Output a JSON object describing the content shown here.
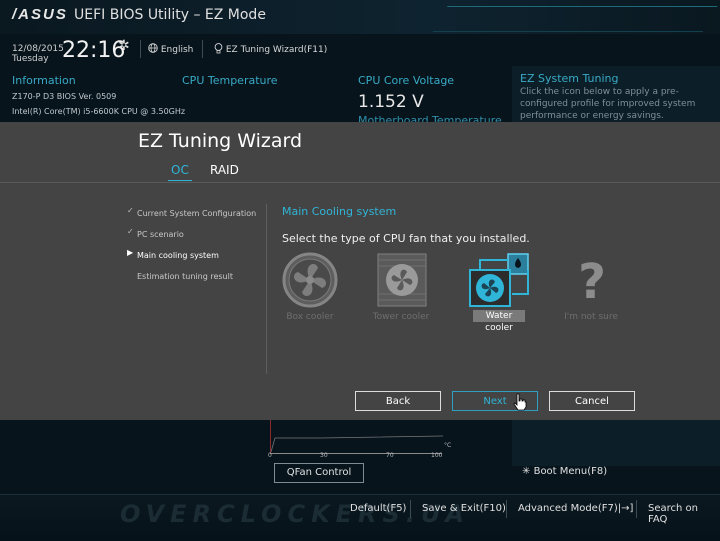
{
  "header": {
    "logo": "/ASUS",
    "title": "UEFI BIOS Utility – EZ Mode"
  },
  "topbar": {
    "date": "12/08/2015",
    "day": "Tuesday",
    "time": "22:16",
    "language": "English",
    "wizard": "EZ Tuning Wizard(F11)"
  },
  "info": {
    "heading": "Information",
    "board": "Z170-P D3    BIOS Ver. 0509",
    "cpu": "Intel(R) Core(TM) i5-6600K CPU @ 3.50GHz"
  },
  "cpu_temp": {
    "heading": "CPU Temperature"
  },
  "cpu_voltage": {
    "heading": "CPU Core Voltage",
    "value": "1.152 V",
    "sub_heading": "Motherboard Temperature"
  },
  "ez_system_tuning": {
    "heading": "EZ System Tuning",
    "description": "Click the icon below to apply a pre-configured profile for improved system performance or energy savings."
  },
  "fan_chart": {
    "ticks": [
      "0",
      "30",
      "70",
      "100"
    ],
    "unit": "°C"
  },
  "qfan_button": "QFan Control",
  "boot_menu": "Boot Menu(F8)",
  "footer": {
    "default": "Default(F5)",
    "save_exit": "Save & Exit(F10)",
    "advanced": "Advanced Mode(F7)|→]",
    "search": "Search on FAQ"
  },
  "wizard": {
    "title": "EZ Tuning Wizard",
    "tabs": [
      {
        "label": "OC"
      },
      {
        "label": "RAID"
      }
    ],
    "steps": [
      {
        "label": "Current System Configuration",
        "mark": "✓"
      },
      {
        "label": "PC scenario",
        "mark": "✓"
      },
      {
        "label": "Main cooling system",
        "mark": "▶"
      },
      {
        "label": "Estimation tuning result",
        "mark": ""
      }
    ],
    "section_title": "Main Cooling system",
    "section_text": "Select the type of CPU fan that you installed.",
    "options": [
      {
        "label": "Box cooler",
        "icon": "box-cooler-icon"
      },
      {
        "label": "Tower cooler",
        "icon": "tower-cooler-icon"
      },
      {
        "label": "Water cooler",
        "icon": "water-cooler-icon",
        "selected": true
      },
      {
        "label": "I'm not sure",
        "icon": "question-icon"
      }
    ],
    "buttons": {
      "back": "Back",
      "next": "Next",
      "cancel": "Cancel"
    }
  },
  "colors": {
    "accent": "#2fb5d8",
    "modal_bg": "#444444",
    "page_bg": "#07141c"
  }
}
